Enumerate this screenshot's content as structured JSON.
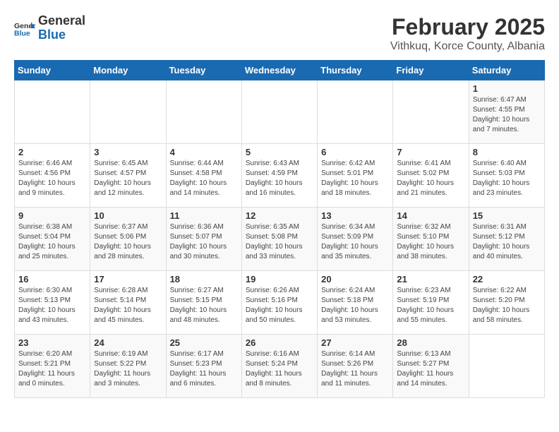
{
  "header": {
    "logo_general": "General",
    "logo_blue": "Blue",
    "title": "February 2025",
    "subtitle": "Vithkuq, Korce County, Albania"
  },
  "days_of_week": [
    "Sunday",
    "Monday",
    "Tuesday",
    "Wednesday",
    "Thursday",
    "Friday",
    "Saturday"
  ],
  "weeks": [
    [
      {
        "day": "",
        "info": ""
      },
      {
        "day": "",
        "info": ""
      },
      {
        "day": "",
        "info": ""
      },
      {
        "day": "",
        "info": ""
      },
      {
        "day": "",
        "info": ""
      },
      {
        "day": "",
        "info": ""
      },
      {
        "day": "1",
        "info": "Sunrise: 6:47 AM\nSunset: 4:55 PM\nDaylight: 10 hours and 7 minutes."
      }
    ],
    [
      {
        "day": "2",
        "info": "Sunrise: 6:46 AM\nSunset: 4:56 PM\nDaylight: 10 hours and 9 minutes."
      },
      {
        "day": "3",
        "info": "Sunrise: 6:45 AM\nSunset: 4:57 PM\nDaylight: 10 hours and 12 minutes."
      },
      {
        "day": "4",
        "info": "Sunrise: 6:44 AM\nSunset: 4:58 PM\nDaylight: 10 hours and 14 minutes."
      },
      {
        "day": "5",
        "info": "Sunrise: 6:43 AM\nSunset: 4:59 PM\nDaylight: 10 hours and 16 minutes."
      },
      {
        "day": "6",
        "info": "Sunrise: 6:42 AM\nSunset: 5:01 PM\nDaylight: 10 hours and 18 minutes."
      },
      {
        "day": "7",
        "info": "Sunrise: 6:41 AM\nSunset: 5:02 PM\nDaylight: 10 hours and 21 minutes."
      },
      {
        "day": "8",
        "info": "Sunrise: 6:40 AM\nSunset: 5:03 PM\nDaylight: 10 hours and 23 minutes."
      }
    ],
    [
      {
        "day": "9",
        "info": "Sunrise: 6:38 AM\nSunset: 5:04 PM\nDaylight: 10 hours and 25 minutes."
      },
      {
        "day": "10",
        "info": "Sunrise: 6:37 AM\nSunset: 5:06 PM\nDaylight: 10 hours and 28 minutes."
      },
      {
        "day": "11",
        "info": "Sunrise: 6:36 AM\nSunset: 5:07 PM\nDaylight: 10 hours and 30 minutes."
      },
      {
        "day": "12",
        "info": "Sunrise: 6:35 AM\nSunset: 5:08 PM\nDaylight: 10 hours and 33 minutes."
      },
      {
        "day": "13",
        "info": "Sunrise: 6:34 AM\nSunset: 5:09 PM\nDaylight: 10 hours and 35 minutes."
      },
      {
        "day": "14",
        "info": "Sunrise: 6:32 AM\nSunset: 5:10 PM\nDaylight: 10 hours and 38 minutes."
      },
      {
        "day": "15",
        "info": "Sunrise: 6:31 AM\nSunset: 5:12 PM\nDaylight: 10 hours and 40 minutes."
      }
    ],
    [
      {
        "day": "16",
        "info": "Sunrise: 6:30 AM\nSunset: 5:13 PM\nDaylight: 10 hours and 43 minutes."
      },
      {
        "day": "17",
        "info": "Sunrise: 6:28 AM\nSunset: 5:14 PM\nDaylight: 10 hours and 45 minutes."
      },
      {
        "day": "18",
        "info": "Sunrise: 6:27 AM\nSunset: 5:15 PM\nDaylight: 10 hours and 48 minutes."
      },
      {
        "day": "19",
        "info": "Sunrise: 6:26 AM\nSunset: 5:16 PM\nDaylight: 10 hours and 50 minutes."
      },
      {
        "day": "20",
        "info": "Sunrise: 6:24 AM\nSunset: 5:18 PM\nDaylight: 10 hours and 53 minutes."
      },
      {
        "day": "21",
        "info": "Sunrise: 6:23 AM\nSunset: 5:19 PM\nDaylight: 10 hours and 55 minutes."
      },
      {
        "day": "22",
        "info": "Sunrise: 6:22 AM\nSunset: 5:20 PM\nDaylight: 10 hours and 58 minutes."
      }
    ],
    [
      {
        "day": "23",
        "info": "Sunrise: 6:20 AM\nSunset: 5:21 PM\nDaylight: 11 hours and 0 minutes."
      },
      {
        "day": "24",
        "info": "Sunrise: 6:19 AM\nSunset: 5:22 PM\nDaylight: 11 hours and 3 minutes."
      },
      {
        "day": "25",
        "info": "Sunrise: 6:17 AM\nSunset: 5:23 PM\nDaylight: 11 hours and 6 minutes."
      },
      {
        "day": "26",
        "info": "Sunrise: 6:16 AM\nSunset: 5:24 PM\nDaylight: 11 hours and 8 minutes."
      },
      {
        "day": "27",
        "info": "Sunrise: 6:14 AM\nSunset: 5:26 PM\nDaylight: 11 hours and 11 minutes."
      },
      {
        "day": "28",
        "info": "Sunrise: 6:13 AM\nSunset: 5:27 PM\nDaylight: 11 hours and 14 minutes."
      },
      {
        "day": "",
        "info": ""
      }
    ]
  ]
}
